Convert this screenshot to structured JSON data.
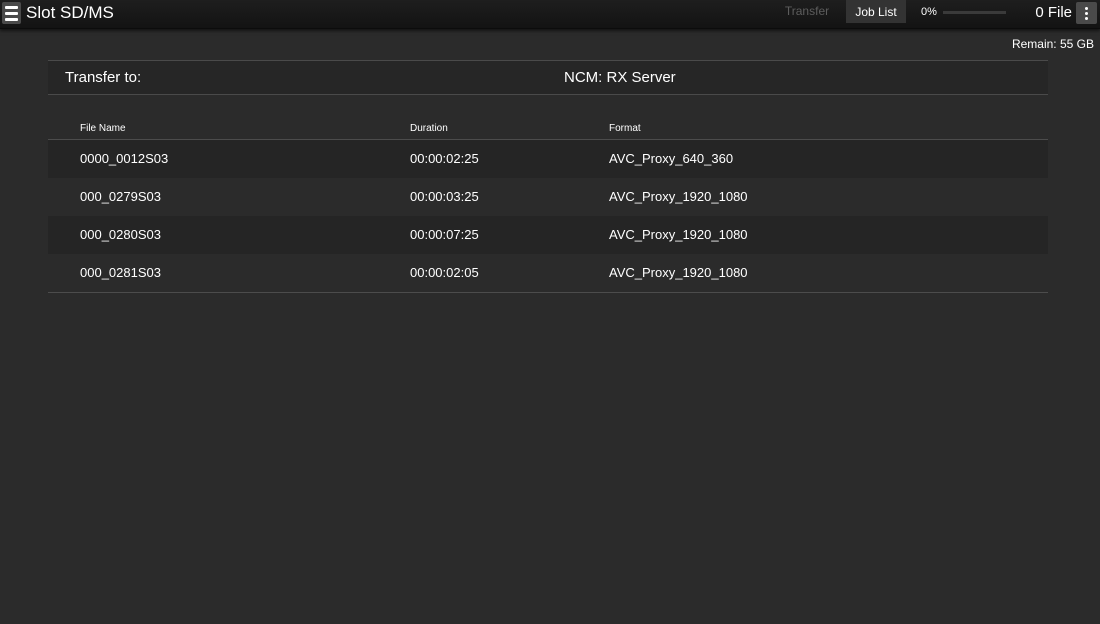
{
  "header": {
    "title": "Slot SD/MS",
    "tabs": [
      {
        "label": "Transfer",
        "active": false
      },
      {
        "label": "Job List",
        "active": true
      }
    ],
    "progress": {
      "label": "0%",
      "value": 0
    },
    "file_count": "0 File"
  },
  "remain": "Remain: 55 GB",
  "destination": {
    "label": "Transfer to:",
    "value": "NCM: RX Server"
  },
  "table": {
    "columns": [
      "File Name",
      "Duration",
      "Format"
    ],
    "rows": [
      {
        "name": "0000_0012S03",
        "duration": "00:00:02:25",
        "format": "AVC_Proxy_640_360"
      },
      {
        "name": "000_0279S03",
        "duration": "00:00:03:25",
        "format": "AVC_Proxy_1920_1080"
      },
      {
        "name": "000_0280S03",
        "duration": "00:00:07:25",
        "format": "AVC_Proxy_1920_1080"
      },
      {
        "name": "000_0281S03",
        "duration": "00:00:02:05",
        "format": "AVC_Proxy_1920_1080"
      }
    ]
  },
  "colors": {
    "background": "#2b2b2b",
    "topbar": "#141414",
    "active_tab": "#333333",
    "inactive_tab_text": "#5d5d5d"
  },
  "icons": {
    "menu": "hamburger-menu-icon",
    "more": "vertical-dots-icon"
  }
}
